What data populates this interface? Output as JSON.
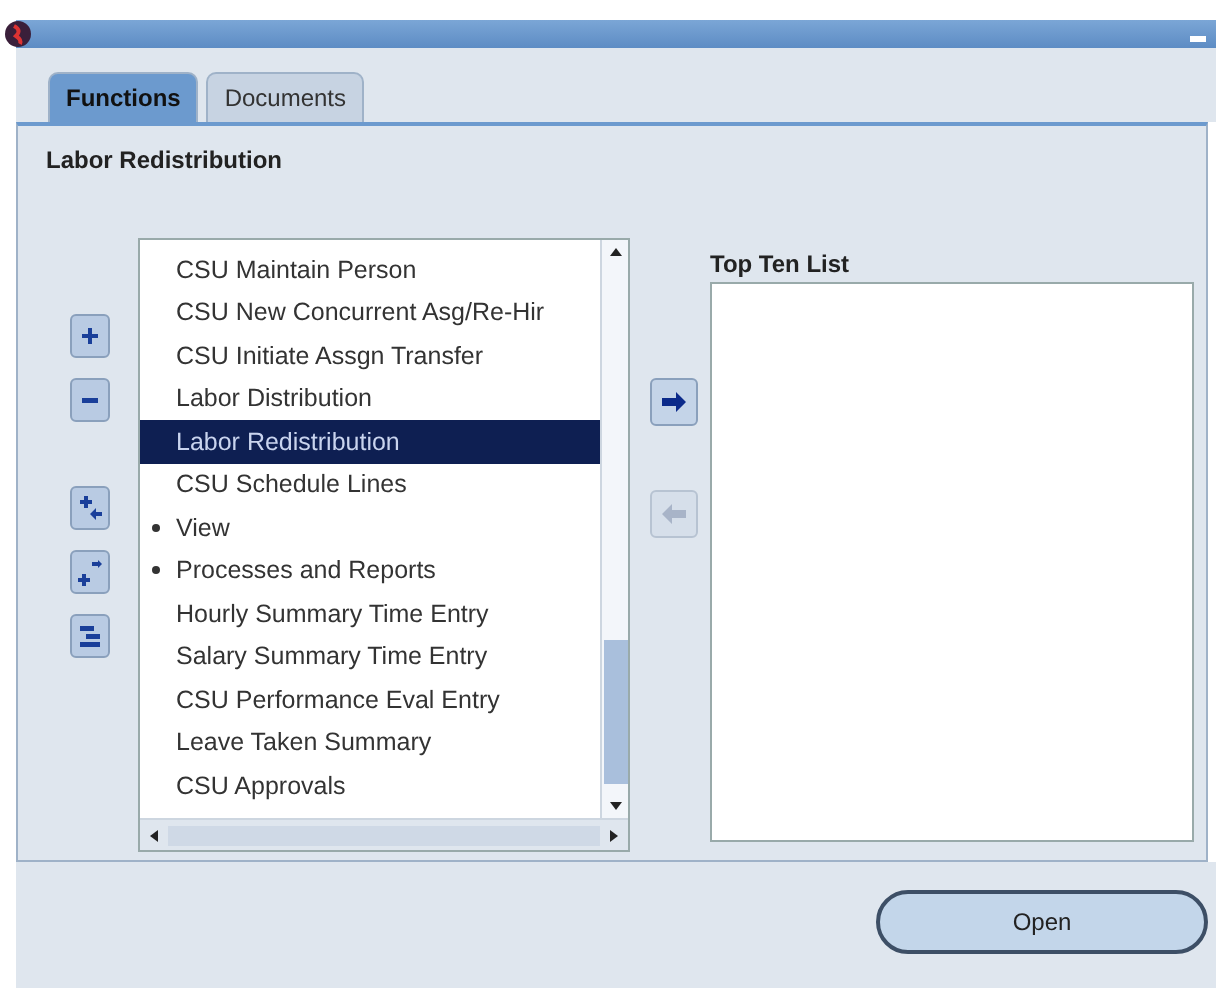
{
  "tabs": [
    {
      "label": "Functions",
      "selected": true
    },
    {
      "label": "Documents",
      "selected": false
    }
  ],
  "heading": "Labor Redistribution",
  "functions": [
    {
      "label": "CSU Maintain Person",
      "kind": "function",
      "selected": false
    },
    {
      "label": "CSU New Concurrent Asg/Re-Hir",
      "kind": "function",
      "selected": false
    },
    {
      "label": "CSU Initiate Assgn Transfer",
      "kind": "function",
      "selected": false
    },
    {
      "label": "Labor Distribution",
      "kind": "function",
      "selected": false
    },
    {
      "label": "Labor Redistribution",
      "kind": "function",
      "selected": true
    },
    {
      "label": "CSU Schedule Lines",
      "kind": "function",
      "selected": false
    },
    {
      "label": "View",
      "kind": "group",
      "selected": false
    },
    {
      "label": "Processes and Reports",
      "kind": "group",
      "selected": false
    },
    {
      "label": "Hourly Summary Time Entry",
      "kind": "function",
      "selected": false
    },
    {
      "label": "Salary Summary Time Entry",
      "kind": "function",
      "selected": false
    },
    {
      "label": "CSU Performance Eval Entry",
      "kind": "function",
      "selected": false
    },
    {
      "label": "Leave Taken Summary",
      "kind": "function",
      "selected": false
    },
    {
      "label": "CSU Approvals",
      "kind": "function",
      "selected": false
    }
  ],
  "top_ten": {
    "label": "Top Ten List"
  },
  "add_button": {
    "disabled": false
  },
  "remove_button": {
    "disabled": true
  },
  "open_button": {
    "label": "Open"
  }
}
